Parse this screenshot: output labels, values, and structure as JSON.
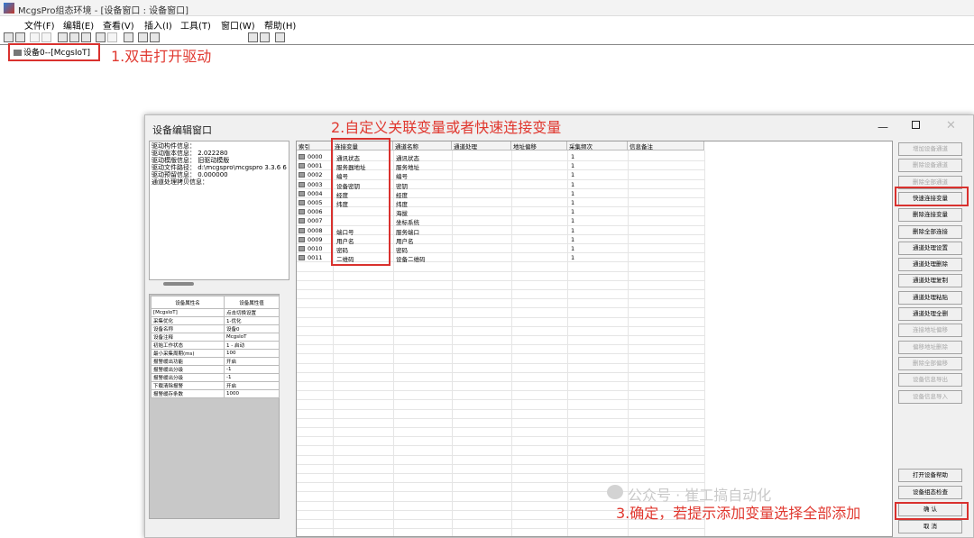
{
  "window": {
    "title": "McgsPro组态环境 - [设备窗口 : 设备窗口]"
  },
  "menu": [
    "文件(F)",
    "编辑(E)",
    "查看(V)",
    "插入(I)",
    "工具(T)",
    "窗口(W)",
    "帮助(H)"
  ],
  "tree": {
    "node_label": "设备0--[McgsIoT]"
  },
  "annotations": {
    "step1": "1.双击打开驱动",
    "step2": "2.自定义关联变量或者快速连接变量",
    "step3": "3.确定，若提示添加变量选择全部添加"
  },
  "dialog": {
    "title": "设备编辑窗口",
    "info_lines": [
      "驱动构件信息：",
      "驱动版本信息：  2.022280",
      "驱动模版信息：  旧驱动模版",
      "驱动文件路径：  d:\\mcgspro\\mcgspro 3.3.6 6",
      "驱动预留信息：  0.000000",
      "通道处理拷贝信息："
    ],
    "props_headers": [
      "设备属性名",
      "设备属性值"
    ],
    "props": [
      [
        "[McgsIoT]",
        "点击切换设置"
      ],
      [
        "采集优化",
        "1-优化"
      ],
      [
        "设备名称",
        "设备0"
      ],
      [
        "设备注释",
        "McgsIoT"
      ],
      [
        "初始工作状态",
        "1 - 启动"
      ],
      [
        "最小采集周期(ms)",
        "100"
      ],
      [
        "报警缓出功能",
        "开启"
      ],
      [
        "报警缓出分级",
        "-1"
      ],
      [
        "报警缓出分级",
        "-1"
      ],
      [
        "下载清除报警",
        "开启"
      ],
      [
        "报警缓存条数",
        "1000"
      ]
    ],
    "grid_headers": [
      "索引",
      "连接变量",
      "通道名称",
      "通道处理",
      "地址偏移",
      "采集频次",
      "信息备注"
    ],
    "rows": [
      {
        "index": "0000",
        "var": "通讯状态",
        "channel": "通讯状态",
        "freq": "1"
      },
      {
        "index": "0001",
        "var": "服务器地址",
        "channel": "服务地址",
        "freq": "1"
      },
      {
        "index": "0002",
        "var": "编号",
        "channel": "编号",
        "freq": "1"
      },
      {
        "index": "0003",
        "var": "设备密钥",
        "channel": "密钥",
        "freq": "1"
      },
      {
        "index": "0004",
        "var": "经度",
        "channel": "经度",
        "freq": "1"
      },
      {
        "index": "0005",
        "var": "纬度",
        "channel": "纬度",
        "freq": "1"
      },
      {
        "index": "0006",
        "var": "",
        "channel": "海拔",
        "freq": "1"
      },
      {
        "index": "0007",
        "var": "",
        "channel": "坐标系统",
        "freq": "1"
      },
      {
        "index": "0008",
        "var": "端口号",
        "channel": "服务端口",
        "freq": "1"
      },
      {
        "index": "0009",
        "var": "用户名",
        "channel": "用户名",
        "freq": "1"
      },
      {
        "index": "0010",
        "var": "密码",
        "channel": "密码",
        "freq": "1"
      },
      {
        "index": "0011",
        "var": "二维码",
        "channel": "设备二维码",
        "freq": "1"
      }
    ],
    "buttons": [
      {
        "label": "增加设备通道",
        "enabled": false
      },
      {
        "label": "删除设备通道",
        "enabled": false
      },
      {
        "label": "删除全部通道",
        "enabled": false
      },
      {
        "label": "快速连接变量",
        "enabled": true
      },
      {
        "label": "删除连接变量",
        "enabled": true
      },
      {
        "label": "删除全部连接",
        "enabled": true
      },
      {
        "label": "通道处理设置",
        "enabled": true
      },
      {
        "label": "通道处理删除",
        "enabled": true
      },
      {
        "label": "通道处理复制",
        "enabled": true
      },
      {
        "label": "通道处理粘贴",
        "enabled": true
      },
      {
        "label": "通道处理全删",
        "enabled": true
      },
      {
        "label": "连接地址偏移",
        "enabled": false
      },
      {
        "label": "偏移地址删除",
        "enabled": false
      },
      {
        "label": "删除全部偏移",
        "enabled": false
      },
      {
        "label": "设备信息导出",
        "enabled": false
      },
      {
        "label": "设备信息导入",
        "enabled": false
      }
    ],
    "bottom_buttons": [
      "打开设备帮助",
      "设备组态检查",
      "确    认",
      "取    消"
    ],
    "watermark": "公众号 · 崔工搞自动化"
  }
}
